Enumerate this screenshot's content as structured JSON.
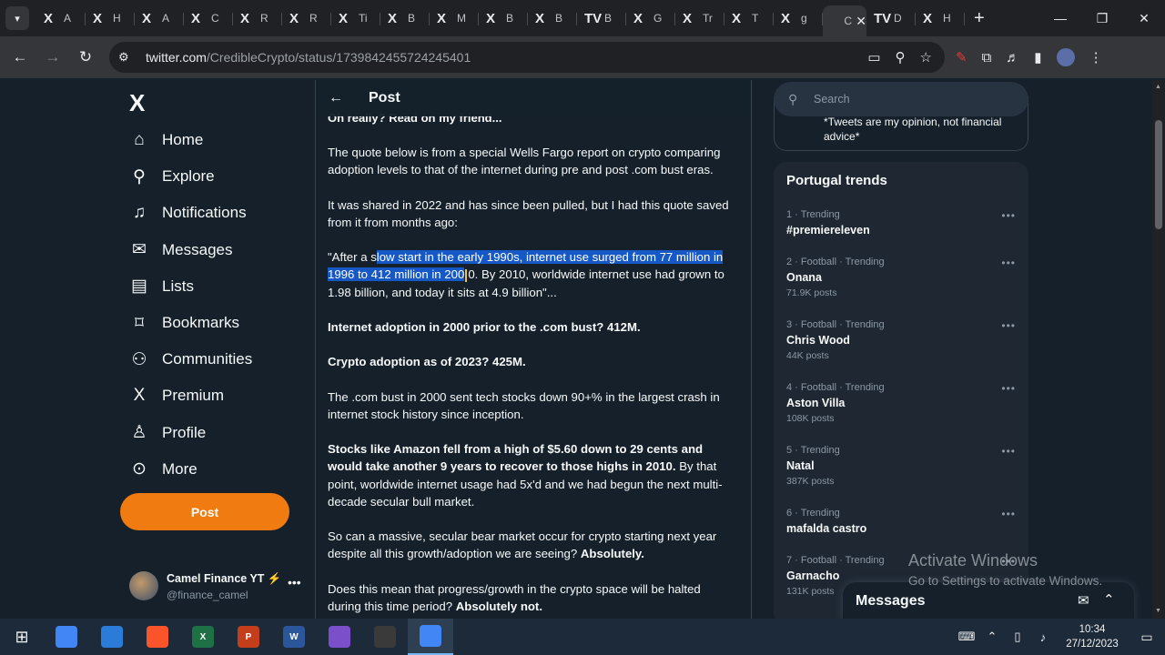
{
  "browser": {
    "tab_menu_icon": "chevron-down-icon",
    "tabs": [
      {
        "favicon": "X",
        "title": "A"
      },
      {
        "favicon": "X",
        "title": "H"
      },
      {
        "favicon": "X",
        "title": "A"
      },
      {
        "favicon": "X",
        "title": "C"
      },
      {
        "favicon": "X",
        "title": "R"
      },
      {
        "favicon": "X",
        "title": "R"
      },
      {
        "favicon": "X",
        "title": "Ti"
      },
      {
        "favicon": "X",
        "title": "B"
      },
      {
        "favicon": "X",
        "title": "M"
      },
      {
        "favicon": "X",
        "title": "B"
      },
      {
        "favicon": "X",
        "title": "B"
      },
      {
        "favicon": "TV",
        "title": "B"
      },
      {
        "favicon": "X",
        "title": "G"
      },
      {
        "favicon": "X",
        "title": "Tr"
      },
      {
        "favicon": "X",
        "title": "T"
      },
      {
        "favicon": "X",
        "title": "g"
      },
      {
        "favicon": "",
        "title": "C",
        "active": true
      },
      {
        "favicon": "TV",
        "title": "D"
      },
      {
        "favicon": "X",
        "title": "H"
      }
    ],
    "url_host": "twitter.com",
    "url_path": "/CredibleCrypto/status/1739842455724245401"
  },
  "nav": {
    "logo": "X",
    "items": [
      {
        "label": "Home",
        "icon": "home-icon",
        "glyph": "⌂"
      },
      {
        "label": "Explore",
        "icon": "search-icon",
        "glyph": "⚲"
      },
      {
        "label": "Notifications",
        "icon": "bell-icon",
        "glyph": "♫"
      },
      {
        "label": "Messages",
        "icon": "envelope-icon",
        "glyph": "✉"
      },
      {
        "label": "Lists",
        "icon": "list-icon",
        "glyph": "▤"
      },
      {
        "label": "Bookmarks",
        "icon": "bookmark-icon",
        "glyph": "⌑"
      },
      {
        "label": "Communities",
        "icon": "people-icon",
        "glyph": "⚇"
      },
      {
        "label": "Premium",
        "icon": "x-premium-icon",
        "glyph": "X"
      },
      {
        "label": "Profile",
        "icon": "person-icon",
        "glyph": "♙"
      },
      {
        "label": "More",
        "icon": "more-circle-icon",
        "glyph": "⊙"
      }
    ],
    "post_label": "Post",
    "account": {
      "name": "Camel Finance YT ⚡",
      "handle": "@finance_camel"
    }
  },
  "main": {
    "header_title": "Post",
    "cut_line": "Oh really? Read on my friend...",
    "paragraphs": {
      "p1": "The quote below is from a special Wells Fargo report on crypto comparing adoption levels to that of the internet during pre and post .com bust eras.",
      "p2": "It was shared in 2022 and has since been pulled, but I had this quote saved from it from months ago:",
      "p3_before": "\"After a s",
      "p3_selected": "low start in the early 1990s, internet use surged from 77 million in 1996 to 412 million in 200",
      "p3_after_cursor": "0. By 2010, worldwide internet use had grown to 1.98 billion, and today it sits at 4.9 billion\"...",
      "p4": "Internet adoption in 2000 prior to the .com bust? 412M.",
      "p5": "Crypto adoption as of 2023? 425M.",
      "p6": "The .com bust in 2000 sent tech stocks down 90+% in the largest crash in internet stock history since inception.",
      "p7_bold": "Stocks like Amazon fell from a high of $5.60 down to 29 cents and would take another 9 years to recover to those highs in 2010.",
      "p7_rest": " By that point, worldwide internet usage had 5x'd and we had begun the next multi-decade secular bull market.",
      "p8": "So can a massive, secular bear market occur for crypto starting next year despite all this growth/adoption we are seeing? ",
      "p8_bold": "Absolutely.",
      "p9": "Does this mean that progress/growth in the crypto space will be halted during this time period? ",
      "p9_bold": "Absolutely not."
    }
  },
  "right": {
    "search_placeholder": "Search",
    "bio_text": "*Tweets are my opinion, not financial advice*",
    "trends_title": "Portugal trends",
    "trends": [
      {
        "meta": "1 · Trending",
        "name": "#premiereleven",
        "count": ""
      },
      {
        "meta": "2 · Football · Trending",
        "name": "Onana",
        "count": "71.9K posts"
      },
      {
        "meta": "3 · Football · Trending",
        "name": "Chris Wood",
        "count": "44K posts"
      },
      {
        "meta": "4 · Football · Trending",
        "name": "Aston Villa",
        "count": "108K posts"
      },
      {
        "meta": "5 · Trending",
        "name": "Natal",
        "count": "387K posts"
      },
      {
        "meta": "6 · Trending",
        "name": "mafalda castro",
        "count": ""
      },
      {
        "meta": "7 · Football · Trending",
        "name": "Garnacho",
        "count": "131K posts"
      }
    ],
    "messages_title": "Messages"
  },
  "watermark": {
    "line1": "Activate Windows",
    "line2": "Go to Settings to activate Windows."
  },
  "taskbar": {
    "apps": [
      {
        "name": "chrome-app",
        "label": "",
        "color": "#4285f4"
      },
      {
        "name": "pc-app",
        "label": "",
        "color": "#2b7bd8"
      },
      {
        "name": "brave-app",
        "label": "",
        "color": "#fb542b"
      },
      {
        "name": "excel-app",
        "label": "X",
        "color": "#1e7145"
      },
      {
        "name": "powerpoint-app",
        "label": "P",
        "color": "#c43e1c"
      },
      {
        "name": "word-app",
        "label": "W",
        "color": "#2b579a"
      },
      {
        "name": "video-editor-app",
        "label": "",
        "color": "#7a4fc9"
      },
      {
        "name": "obs-app",
        "label": "",
        "color": "#3a3a3a"
      },
      {
        "name": "chrome-profile-app",
        "label": "",
        "color": "#4285f4",
        "active": true
      }
    ],
    "time": "10:34",
    "date": "27/12/2023"
  }
}
